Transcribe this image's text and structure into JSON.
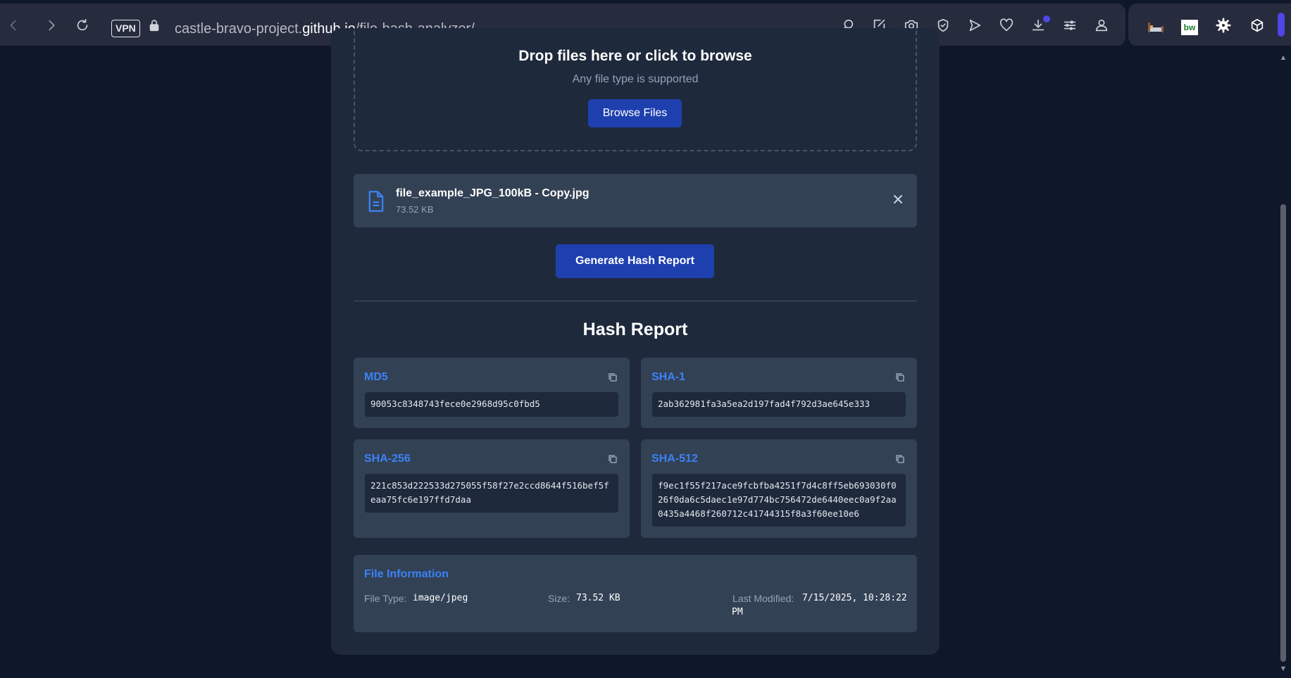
{
  "browser": {
    "vpn_label": "VPN",
    "url_prefix": "castle-bravo-project.",
    "url_host": "github.io",
    "url_path": "/file-hash-analyzer/",
    "accent_color": "#4f46e5"
  },
  "dropzone": {
    "title": "Drop files here or click to browse",
    "subtitle": "Any file type is supported",
    "browse_label": "Browse Files"
  },
  "file": {
    "name": "file_example_JPG_100kB - Copy.jpg",
    "size": "73.52 KB"
  },
  "generate_label": "Generate Hash Report",
  "report": {
    "title": "Hash Report",
    "hashes": [
      {
        "algorithm": "MD5",
        "value": "90053c8348743fece0e2968d95c0fbd5"
      },
      {
        "algorithm": "SHA-1",
        "value": "2ab362981fa3a5ea2d197fad4f792d3ae645e333"
      },
      {
        "algorithm": "SHA-256",
        "value": "221c853d222533d275055f58f27e2ccd8644f516bef5feaa75fc6e197ffd7daa"
      },
      {
        "algorithm": "SHA-512",
        "value": "f9ec1f55f217ace9fcbfba4251f7d4c8ff5eb693030f026f0da6c5daec1e97d774bc756472de6440eec0a9f2aa0435a4468f260712c41744315f8a3f60ee10e6"
      }
    ],
    "file_info": {
      "title": "File Information",
      "type_label": "File Type:",
      "type_value": "image/jpeg",
      "size_label": "Size:",
      "size_value": "73.52 KB",
      "modified_label": "Last Modified:",
      "modified_value": "7/15/2025, 10:28:22 PM"
    }
  },
  "colors": {
    "page_bg": "#0f172a",
    "card_bg": "#1e293b",
    "panel_bg": "#334155",
    "button_bg": "#1e40af",
    "label_blue": "#3b82f6"
  }
}
